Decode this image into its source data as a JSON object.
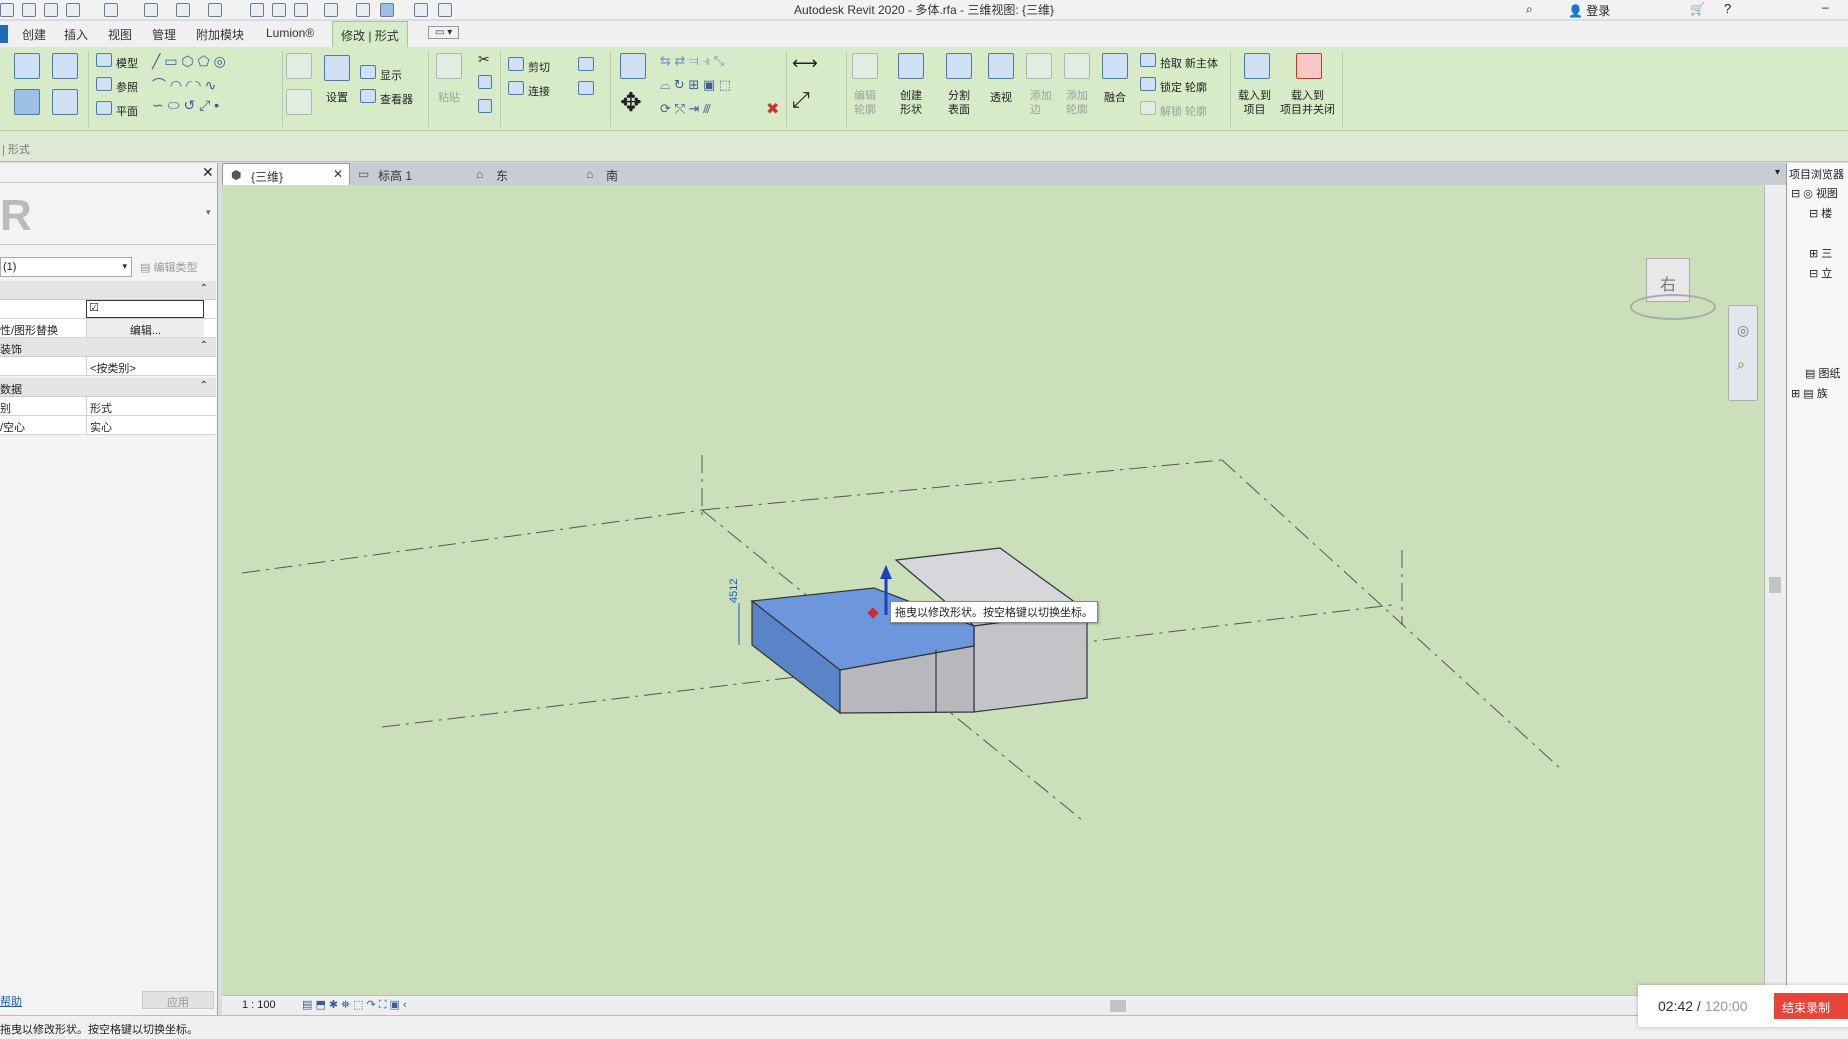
{
  "app": {
    "title": "Autodesk Revit 2020 - 多体.rfa - 三维视图: {三维}",
    "login": "登录"
  },
  "menu": {
    "tabs": [
      "创建",
      "插入",
      "视图",
      "管理",
      "附加模块",
      "Lumion®"
    ],
    "active_tab": "修改 | 形式"
  },
  "ribbon": {
    "select": [
      "模型",
      "参照",
      "平面"
    ],
    "workplane": {
      "set": "设置",
      "show": "显示",
      "viewer": "查看器"
    },
    "clipboard": {
      "paste": "粘贴"
    },
    "geometry": {
      "cut": "剪切",
      "join": "连接"
    },
    "form": {
      "edit_profile": "编辑\n轮廓",
      "create_form": "创建\n形状",
      "divide_surface": "分割\n表面",
      "xray": "透视",
      "add_edge": "添加\n边",
      "add_profile": "添加\n轮廓",
      "dissolve": "融合",
      "pick_host": "拾取 新主体",
      "lock_profile": "锁定 轮廓",
      "unlock_profile": "解锁 轮廓"
    },
    "family": {
      "load_into_project": "载入到\n项目",
      "load_and_close": "载入到\n项目并关闭"
    }
  },
  "options_bar": {
    "text": "| 形式"
  },
  "properties": {
    "type_selector": "(1)",
    "edit_type": "编辑类型",
    "rows": [
      {
        "label": "",
        "value": "☑"
      },
      {
        "label": "性/图形替换",
        "value": "编辑..."
      }
    ],
    "section1": "装饰",
    "material": "<按类别>",
    "section2": "数据",
    "subcategory": {
      "label": "别",
      "value": "形式"
    },
    "solid_void": {
      "label": "/空心",
      "value": "实心"
    },
    "help": "帮助",
    "apply": "应用"
  },
  "view_tabs": [
    {
      "label": "{三维}",
      "active": true
    },
    {
      "label": "标高 1",
      "active": false
    },
    {
      "label": "东",
      "active": false
    },
    {
      "label": "南",
      "active": false
    }
  ],
  "viewport": {
    "tooltip": "拖曳以修改形状。按空格键以切换坐标。",
    "dimension": "4512",
    "viewcube_face": "右",
    "colors": {
      "background": "#cbdfba",
      "selected_face": "#6d97dc",
      "grey_face": "#cfd0d4"
    }
  },
  "view_control": {
    "scale": "1 : 100"
  },
  "browser": {
    "title": "项目浏览器",
    "items": [
      "视图",
      "楼",
      "三",
      "立",
      "图纸",
      "族"
    ]
  },
  "status": {
    "text": "拖曳以修改形状。按空格键以切换坐标。"
  },
  "recorder": {
    "elapsed": "02:42",
    "total": "120:00",
    "stop": "结束录制"
  }
}
